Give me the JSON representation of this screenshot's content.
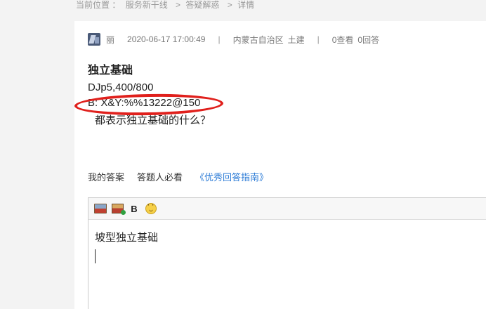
{
  "breadcrumb": {
    "location_label": "当前位置 ：",
    "items": [
      "服务新干线",
      "答疑解惑",
      "详情"
    ],
    "separator": ">"
  },
  "question": {
    "author": "丽",
    "datetime": "2020-06-17 17:00:49",
    "divider": "|",
    "region": "内蒙古自治区",
    "category": "土建",
    "views": "0查看",
    "answers": "0回答",
    "title": "独立基础",
    "body_lines": [
      "DJp5,400/800",
      "B: X&Y:%%13222@150",
      "都表示独立基础的什么？"
    ]
  },
  "answer_section": {
    "tabs": [
      "我的答案",
      "答题人必看"
    ],
    "guide_link": "《优秀回答指南》"
  },
  "editor": {
    "toolbar_icons": [
      "insert-image-icon",
      "upload-image-icon",
      "bold-icon",
      "emoji-icon"
    ],
    "bold_label": "B",
    "content": "坡型独立基础"
  },
  "colors": {
    "highlight_ellipse": "#e0201c",
    "link": "#2a7ad6"
  }
}
